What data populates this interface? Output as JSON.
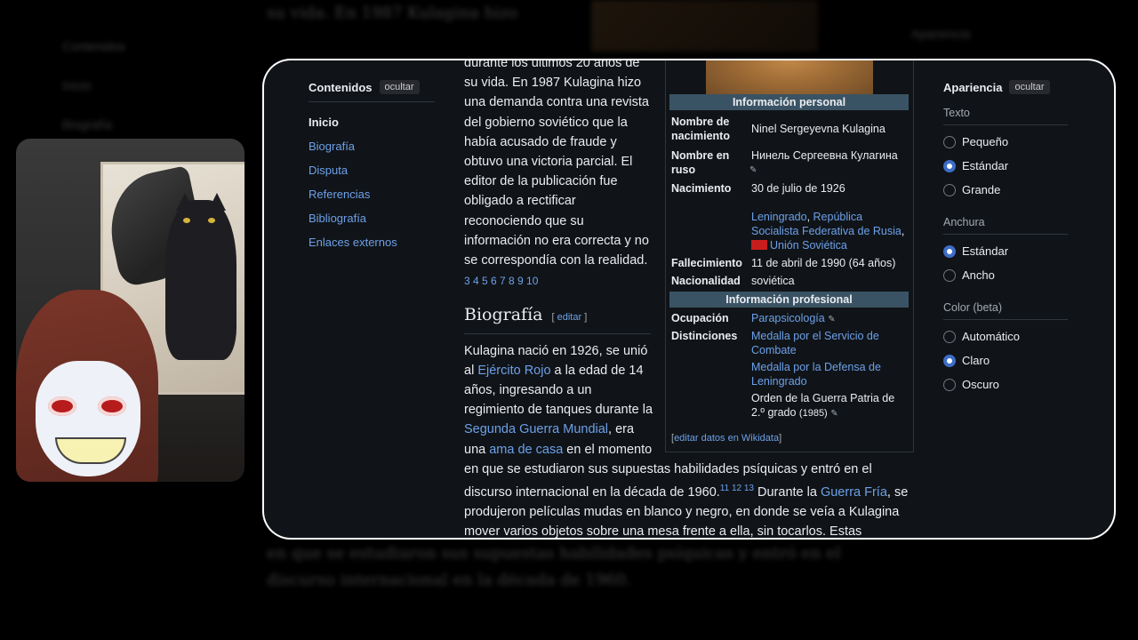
{
  "toc": {
    "title": "Contenidos",
    "hide_label": "ocultar",
    "items": [
      "Inicio",
      "Biografía",
      "Disputa",
      "Referencias",
      "Bibliografía",
      "Enlaces externos"
    ]
  },
  "article": {
    "intro_lines": [
      "durante los últimos 20 años de",
      "su vida. En 1987 Kulagina hizo",
      "una demanda contra una revista",
      "del gobierno soviético que la",
      "había acusado de fraude y",
      "obtuvo una victoria parcial. El",
      "editor de la publicación fue",
      "obligado a rectificar",
      "reconociendo que su",
      "información no era correcta y no",
      "se correspondía con la realidad."
    ],
    "intro_refs": "3 4 5 6 7 8 9 10",
    "section_title": "Biografía",
    "edit_label": "editar",
    "bio": {
      "t1": "Kulagina nació en 1926, se unió al ",
      "l1": "Ejército Rojo",
      "t2": " a la edad de 14 años, ingresando a un regimiento de tanques durante la ",
      "l2": "Segunda Guerra Mundial",
      "t3": ", era una ",
      "l3": "ama de casa",
      "t4": " en el momento",
      "t5": "en que se estudiaron sus supuestas habilidades psíquicas y entró en el discurso internacional en la década de 1960.",
      "refs": "11 12 13",
      "t6": " Durante la ",
      "l4": "Guerra Fría",
      "t7": ", se produjeron películas mudas en blanco y negro, en donde se veía a Kulagina mover varios objetos sobre una mesa frente a ella, sin tocarlos. Estas películas"
    }
  },
  "infobox": {
    "personal_header": "Información personal",
    "professional_header": "Información profesional",
    "birth_name_label": "Nombre de nacimiento",
    "birth_name": "Ninel Sergeyevna Kulagina",
    "russian_name_label": "Nombre en ruso",
    "russian_name": "Нинель Сергеевна Кулагина",
    "birth_label": "Nacimiento",
    "birth_date": "30 de julio de 1926",
    "birth_place_1": "Leningrado",
    "birth_place_2": "República Socialista Federativa de Rusia",
    "birth_place_3": "Unión Soviética",
    "death_label": "Fallecimiento",
    "death": "11 de abril de 1990 (64 años)",
    "nationality_label": "Nacionalidad",
    "nationality": "soviética",
    "occupation_label": "Ocupación",
    "occupation": "Parapsicología",
    "awards_label": "Distinciones",
    "award_1": "Medalla por el Servicio de Combate",
    "award_2": "Medalla por la Defensa de Leningrado",
    "award_3": "Orden de la Guerra Patria de 2.º grado",
    "award_3_year": "(1985)",
    "wikidata_edit": "editar datos en Wikidata"
  },
  "appearance": {
    "title": "Apariencia",
    "hide_label": "ocultar",
    "text_title": "Texto",
    "text_options": [
      "Pequeño",
      "Estándar",
      "Grande"
    ],
    "text_selected": "Estándar",
    "width_title": "Anchura",
    "width_options": [
      "Estándar",
      "Ancho"
    ],
    "width_selected": "Estándar",
    "color_title": "Color (beta)",
    "color_options": [
      "Automático",
      "Claro",
      "Oscuro"
    ],
    "color_selected": "Claro"
  },
  "colors": {
    "link": "#6da0e8",
    "background": "#101418",
    "infobox_header": "#3a5364",
    "radio_selected": "#3e6dc7"
  }
}
